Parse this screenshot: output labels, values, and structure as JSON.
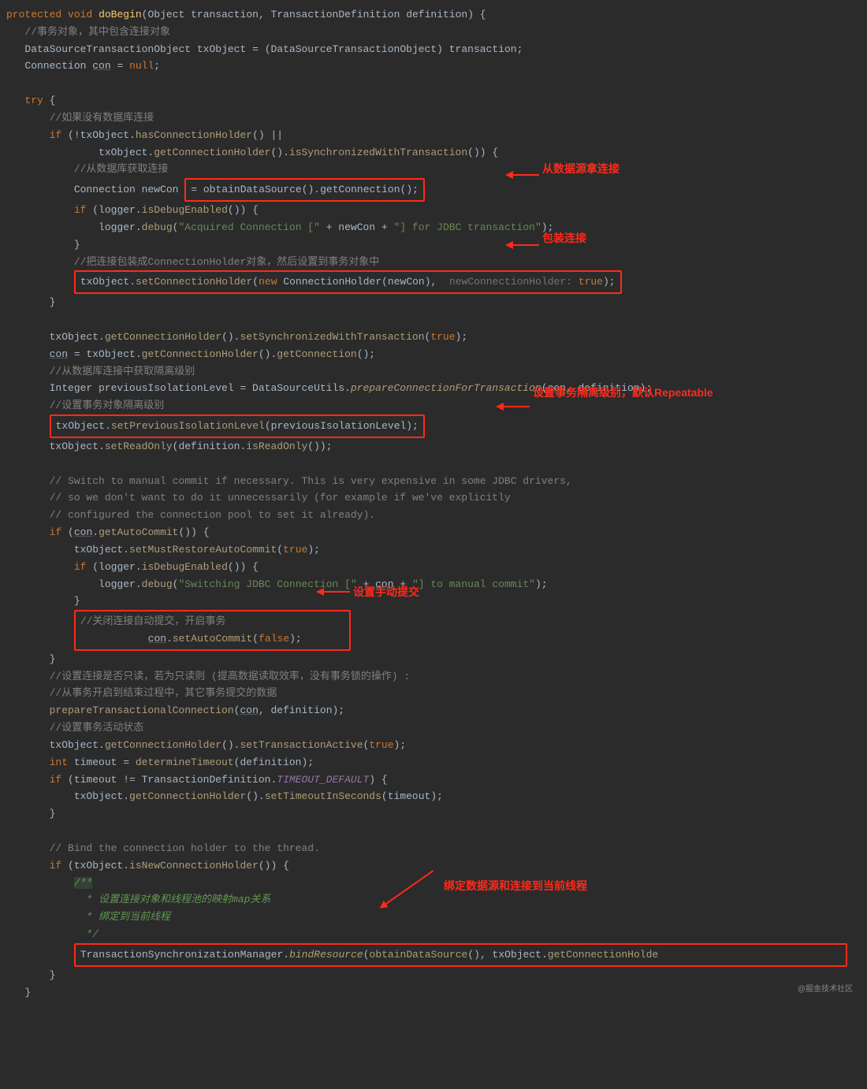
{
  "sig": {
    "kw_protected": "protected",
    "kw_void": "void",
    "name": "doBegin",
    "p1t": "Object",
    "p1n": "transaction",
    "p2t": "TransactionDefinition",
    "p2n": "definition"
  },
  "c1": "//事务对象，其中包含连接对象",
  "decl1": {
    "type": "DataSourceTransactionObject",
    "var": "txObject",
    "cast": "(DataSourceTransactionObject)",
    "rhs": "transaction"
  },
  "decl2": {
    "type": "Connection",
    "var": "con",
    "eq": "=",
    "null": "null"
  },
  "try": "try",
  "c2": "//如果没有数据库连接",
  "if1a": "if",
  "if1b": "(!txObject.",
  "if1c": "hasConnectionHolder",
  "if1d": "() ||",
  "if1e_pre": "txObject.",
  "if1e_a": "getConnectionHolder",
  "if1e_mid": "().",
  "if1e_b": "isSynchronizedWithTransaction",
  "if1e_post": "()) {",
  "c3": "//从数据库获取连接",
  "l_con": {
    "type": "Connection",
    "var": "newCon"
  },
  "box1": "= obtainDataSource().getConnection();",
  "log1": {
    "if": "if",
    "cond_pre": "(logger.",
    "cond_call": "isDebugEnabled",
    "cond_post": "()) {",
    "body_pre": "logger.",
    "body_call": "debug",
    "body_open": "(",
    "s1": "\"Acquired Connection [\"",
    "plus1": " + newCon + ",
    "s2": "\"] for JDBC transaction\"",
    "body_close": ");"
  },
  "c4": "//把连接包装成ConnectionHolder对象，然后设置到事务对象中",
  "box2_a": "txObject.",
  "box2_b": "setConnectionHolder",
  "box2_c": "(",
  "box2_new": "new",
  "box2_d": " ConnectionHolder(newCon),  ",
  "box2_hint": "newConnectionHolder:",
  "box2_true": " true",
  "box2_end": ");",
  "l_sync_a": "txObject.",
  "l_sync_b": "getConnectionHolder",
  "l_sync_c": "().",
  "l_sync_d": "setSynchronizedWithTransaction",
  "l_sync_e": "(",
  "l_sync_true": "true",
  "l_sync_f": ");",
  "l_con2_a": "con",
  "l_con2_b": " = txObject.",
  "l_con2_c": "getConnectionHolder",
  "l_con2_d": "().",
  "l_con2_e": "getConnection",
  "l_con2_f": "();",
  "c5": "//从数据库连接中获取隔离级别",
  "l_iso_a": "Integer previousIsolationLevel = DataSourceUtils.",
  "l_iso_b": "prepareConnectionForTransaction",
  "l_iso_c": "(",
  "l_iso_con": "con",
  "l_iso_d": ", definition);",
  "c6": "//设置事务对象隔离级别",
  "box3_a": "txObject.",
  "box3_b": "setPreviousIsolationLevel",
  "box3_c": "(previousIsolationLevel);",
  "l_ro_a": "txObject.",
  "l_ro_b": "setReadOnly",
  "l_ro_c": "(definition.",
  "l_ro_d": "isReadOnly",
  "l_ro_e": "());",
  "cmt_block1": "// Switch to manual commit if necessary. This is very expensive in some JDBC drivers,",
  "cmt_block2": "// so we don't want to do it unnecessarily (for example if we've explicitly",
  "cmt_block3": "// configured the connection pool to set it already).",
  "auto_if": "if",
  "auto_cond_a": "(",
  "auto_cond_con": "con",
  "auto_cond_b": ".",
  "auto_cond_c": "getAutoCommit",
  "auto_cond_d": "()) {",
  "auto_l1_a": "txObject.",
  "auto_l1_b": "setMustRestoreAutoCommit",
  "auto_l1_c": "(",
  "auto_l1_true": "true",
  "auto_l1_d": ");",
  "log2": {
    "if": "if",
    "cond_pre": "(logger.",
    "cond_call": "isDebugEnabled",
    "cond_post": "()) {",
    "body_pre": "logger.",
    "body_call": "debug",
    "body_open": "(",
    "s1": "\"Switching JDBC Connection [\"",
    "plus1": " + ",
    "con": "con",
    "plus2": " + ",
    "s2": "\"] to manual commit\"",
    "body_close": ");"
  },
  "c7": "//关闭连接自动提交，开启事务",
  "box4_a": "con",
  "box4_b": ".",
  "box4_c": "setAutoCommit",
  "box4_d": "(",
  "box4_false": "false",
  "box4_e": ");",
  "c8": "//设置连接是否只读，若为只读则 (提高数据读取效率，没有事务锁的操作) :",
  "c9": "//从事务开启到结束过程中，其它事务提交的数据",
  "l_prep_a": "prepareTransactionalConnection",
  "l_prep_b": "(",
  "l_prep_con": "con",
  "l_prep_c": ", definition);",
  "c10": "//设置事务活动状态",
  "l_act_a": "txObject.",
  "l_act_b": "getConnectionHolder",
  "l_act_c": "().",
  "l_act_d": "setTransactionActive",
  "l_act_e": "(",
  "l_act_true": "true",
  "l_act_f": ");",
  "l_to1_a": "int",
  "l_to1_b": " timeout = ",
  "l_to1_c": "determineTimeout",
  "l_to1_d": "(definition);",
  "l_to2_if": "if",
  "l_to2_a": " (timeout != TransactionDefinition.",
  "l_to2_b": "TIMEOUT_DEFAULT",
  "l_to2_c": ") {",
  "l_to3_a": "txObject.",
  "l_to3_b": "getConnectionHolder",
  "l_to3_c": "().",
  "l_to3_d": "setTimeoutInSeconds",
  "l_to3_e": "(timeout);",
  "cmt_bind": "// Bind the connection holder to the thread.",
  "bind_if": "if",
  "bind_a": " (txObject.",
  "bind_b": "isNewConnectionHolder",
  "bind_c": "()) {",
  "doc1": "/**",
  "doc2": " * 设置连接对象和线程池的映射map关系",
  "doc3": " * 绑定到当前线程",
  "doc4": " */",
  "box5_a": "TransactionSynchronizationManager.",
  "box5_b": "bindResource",
  "box5_c": "(",
  "box5_d": "obtainDataSource",
  "box5_e": "(), txObject.",
  "box5_f": "getConnectionHolde",
  "annot1": "从数据源拿连接",
  "annot2": "包装连接",
  "annot3": "设置事务隔离级别，默认Repeatable",
  "annot4": "设置手动提交",
  "annot5": "绑定数据源和连接到当前线程",
  "watermark": "@掘金技术社区"
}
